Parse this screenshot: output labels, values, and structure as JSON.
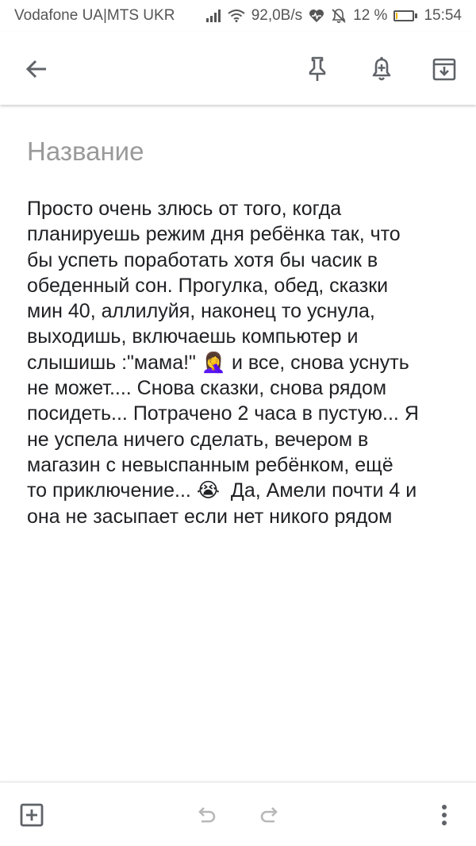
{
  "status_bar": {
    "carrier": "Vodafone UA|MTS UKR",
    "speed": "92,0B/s",
    "battery": "12 %",
    "battery_level": 0.12,
    "time": "15:54",
    "icons": [
      "signal-icon",
      "wifi-icon",
      "heart-icon",
      "mute-icon",
      "battery-icon"
    ]
  },
  "toolbar": {
    "icons": [
      "back-arrow-icon",
      "pin-icon",
      "reminder-icon",
      "archive-icon"
    ]
  },
  "note": {
    "title_placeholder": "Название",
    "body": "Просто очень злюсь от того, когда\nпланируешь режим дня ребёнка так, что\nбы успеть поработать хотя бы часик в\nобеденный сон. Прогулка, обед, сказки\nмин 40, аллилуйя, наконец то уснула,\nвыходишь, включаешь компьютер и\nслышишь :\"мама!\" 🤦‍♀️ и все, снова уснуть\nне может.... Снова сказки, снова рядом\nпосидеть... Потрачено 2 часа в пустую... Я\nне успела ничего сделать, вечером в\nмагазин с невыспанным ребёнком, ещё\nто приключение... 😭  Да, Амели почти 4 и\nона не засыпает если нет никого рядом"
  },
  "bottom_bar": {
    "icons": [
      "add-box-icon",
      "undo-icon",
      "redo-icon",
      "more-vert-icon"
    ]
  },
  "colors": {
    "icon": "#5f6368",
    "text": "#202124",
    "placeholder": "#9a9a9a",
    "battery_fill": "#f2b705"
  }
}
